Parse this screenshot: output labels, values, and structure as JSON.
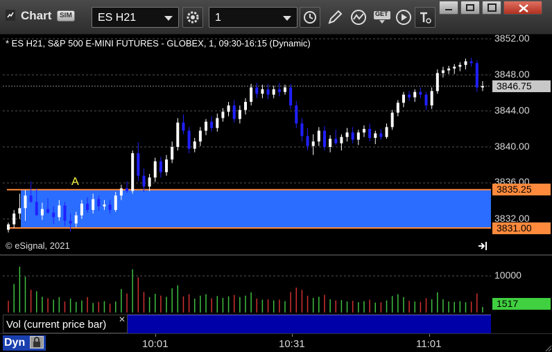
{
  "titlebar": {
    "title": "Chart",
    "badge": "SIM",
    "symbol": "ES H21",
    "interval": "1",
    "buttons": [
      "gear-icon",
      "clock-icon",
      "pencil-icon",
      "studies-icon",
      "get-icon",
      "play-icon",
      "text-icon"
    ],
    "get_label": "GET",
    "window_buttons": [
      "minimize",
      "restore",
      "maximize",
      "close"
    ]
  },
  "chart": {
    "header": "* ES H21, S&P 500 E-MINI FUTURES - GLOBEX, 1, 09:30-16:15 (Dynamic)",
    "copyright": "© eSignal, 2021",
    "marker_label": "A",
    "colors": {
      "up": "#ffffff",
      "down": "#2020ff",
      "zone": "#2a6dff",
      "zone_line": "#ff8a3d",
      "price_tag": "#c8c8c8"
    }
  },
  "price_axis": {
    "labels": [
      "3852.00",
      "3848.00",
      "3844.00",
      "3840.00",
      "3836.00",
      "3832.00"
    ],
    "last_price": "3846.75",
    "zone_high": "3835.25",
    "zone_low": "3831.00"
  },
  "volume": {
    "legend": "Vol (current price bar)",
    "axis_label": "10000",
    "last_volume": "1517",
    "colors": {
      "up": "#3fbf3f",
      "down": "#d03030",
      "tag": "#40d040"
    }
  },
  "time_axis": {
    "labels": [
      "10:01",
      "10:31",
      "11:01"
    ],
    "mode": "Dyn"
  },
  "chart_data": {
    "type": "candlestick",
    "ylim": [
      3830.0,
      3852.5
    ],
    "zone": [
      3831.0,
      3835.25
    ],
    "candles": [
      [
        3830.8,
        3831.6,
        3830.5,
        3831.4
      ],
      [
        3831.4,
        3833.0,
        3831.0,
        3832.6
      ],
      [
        3832.6,
        3834.8,
        3832.0,
        3833.2
      ],
      [
        3833.2,
        3835.2,
        3831.8,
        3834.6
      ],
      [
        3834.6,
        3836.2,
        3833.8,
        3833.9
      ],
      [
        3833.9,
        3835.4,
        3832.9,
        3832.4
      ],
      [
        3832.4,
        3833.8,
        3831.9,
        3833.1
      ],
      [
        3833.1,
        3834.3,
        3832.6,
        3832.7
      ],
      [
        3832.7,
        3833.4,
        3831.4,
        3832.2
      ],
      [
        3832.2,
        3834.1,
        3831.8,
        3833.5
      ],
      [
        3833.5,
        3833.9,
        3831.2,
        3831.8
      ],
      [
        3831.8,
        3832.6,
        3830.6,
        3831.5
      ],
      [
        3831.5,
        3832.8,
        3831.1,
        3832.4
      ],
      [
        3832.4,
        3834.1,
        3832.0,
        3833.7
      ],
      [
        3833.7,
        3834.4,
        3832.7,
        3833.0
      ],
      [
        3833.0,
        3834.8,
        3832.6,
        3834.2
      ],
      [
        3834.2,
        3834.6,
        3832.9,
        3833.4
      ],
      [
        3833.4,
        3834.1,
        3833.0,
        3833.6
      ],
      [
        3833.6,
        3834.1,
        3832.6,
        3833.0
      ],
      [
        3833.0,
        3835.0,
        3832.8,
        3834.6
      ],
      [
        3834.6,
        3835.8,
        3834.1,
        3835.4
      ],
      [
        3835.4,
        3836.2,
        3834.9,
        3835.1
      ],
      [
        3835.1,
        3839.6,
        3834.8,
        3839.3
      ],
      [
        3839.3,
        3840.5,
        3836.2,
        3836.8
      ],
      [
        3836.8,
        3837.6,
        3835.0,
        3835.6
      ],
      [
        3835.6,
        3837.0,
        3835.1,
        3836.6
      ],
      [
        3836.6,
        3838.8,
        3836.1,
        3838.4
      ],
      [
        3838.4,
        3838.9,
        3836.6,
        3837.2
      ],
      [
        3837.2,
        3839.1,
        3836.8,
        3838.6
      ],
      [
        3838.6,
        3840.6,
        3838.2,
        3840.0
      ],
      [
        3840.0,
        3843.2,
        3839.6,
        3842.7
      ],
      [
        3842.7,
        3843.6,
        3841.4,
        3841.8
      ],
      [
        3841.8,
        3842.2,
        3839.3,
        3839.8
      ],
      [
        3839.8,
        3841.0,
        3839.4,
        3840.6
      ],
      [
        3840.6,
        3842.2,
        3840.1,
        3841.8
      ],
      [
        3841.8,
        3843.1,
        3841.3,
        3842.8
      ],
      [
        3842.8,
        3843.4,
        3841.7,
        3842.1
      ],
      [
        3842.1,
        3843.7,
        3841.7,
        3843.2
      ],
      [
        3843.2,
        3844.3,
        3842.8,
        3843.9
      ],
      [
        3843.9,
        3845.0,
        3843.4,
        3844.6
      ],
      [
        3844.6,
        3845.2,
        3842.7,
        3843.1
      ],
      [
        3843.1,
        3844.6,
        3842.6,
        3844.1
      ],
      [
        3844.1,
        3845.4,
        3843.6,
        3845.0
      ],
      [
        3845.0,
        3847.0,
        3844.6,
        3846.6
      ],
      [
        3846.6,
        3847.1,
        3845.4,
        3845.9
      ],
      [
        3845.9,
        3846.9,
        3845.4,
        3846.4
      ],
      [
        3846.4,
        3847.0,
        3845.3,
        3845.8
      ],
      [
        3845.8,
        3846.8,
        3845.4,
        3846.4
      ],
      [
        3846.4,
        3847.1,
        3845.6,
        3846.1
      ],
      [
        3846.1,
        3846.9,
        3845.8,
        3846.6
      ],
      [
        3846.6,
        3847.0,
        3844.2,
        3844.6
      ],
      [
        3844.6,
        3845.1,
        3842.1,
        3842.6
      ],
      [
        3842.6,
        3843.2,
        3840.6,
        3841.2
      ],
      [
        3841.2,
        3842.1,
        3839.6,
        3840.1
      ],
      [
        3840.1,
        3841.4,
        3839.1,
        3840.6
      ],
      [
        3840.6,
        3842.2,
        3840.1,
        3841.8
      ],
      [
        3841.8,
        3842.3,
        3839.6,
        3840.0
      ],
      [
        3840.0,
        3841.3,
        3839.4,
        3840.9
      ],
      [
        3840.9,
        3841.9,
        3840.2,
        3840.4
      ],
      [
        3840.4,
        3841.4,
        3839.6,
        3841.1
      ],
      [
        3841.1,
        3842.1,
        3840.6,
        3841.6
      ],
      [
        3841.6,
        3842.2,
        3840.4,
        3840.8
      ],
      [
        3840.8,
        3841.9,
        3840.2,
        3841.6
      ],
      [
        3841.6,
        3842.4,
        3841.1,
        3842.0
      ],
      [
        3842.0,
        3842.6,
        3840.6,
        3841.0
      ],
      [
        3841.0,
        3841.8,
        3840.3,
        3841.5
      ],
      [
        3841.5,
        3842.0,
        3840.8,
        3841.1
      ],
      [
        3841.1,
        3842.6,
        3840.9,
        3842.2
      ],
      [
        3842.2,
        3844.1,
        3841.9,
        3843.8
      ],
      [
        3843.8,
        3845.2,
        3843.4,
        3844.9
      ],
      [
        3844.9,
        3846.1,
        3844.4,
        3845.8
      ],
      [
        3845.8,
        3846.2,
        3845.1,
        3845.5
      ],
      [
        3845.5,
        3846.4,
        3845.0,
        3846.1
      ],
      [
        3846.1,
        3846.6,
        3845.4,
        3845.8
      ],
      [
        3845.8,
        3846.1,
        3844.1,
        3844.6
      ],
      [
        3844.6,
        3846.6,
        3844.2,
        3846.2
      ],
      [
        3846.2,
        3848.6,
        3845.9,
        3848.2
      ],
      [
        3848.2,
        3848.9,
        3847.7,
        3848.5
      ],
      [
        3848.5,
        3849.0,
        3848.1,
        3848.7
      ],
      [
        3848.7,
        3849.2,
        3848.1,
        3848.9
      ],
      [
        3848.9,
        3849.4,
        3848.4,
        3849.1
      ],
      [
        3849.1,
        3849.8,
        3848.6,
        3849.5
      ],
      [
        3849.5,
        3849.9,
        3848.9,
        3849.3
      ],
      [
        3849.3,
        3849.6,
        3846.1,
        3846.6
      ],
      [
        3846.6,
        3847.3,
        3846.2,
        3846.75
      ]
    ],
    "volume": [
      [
        3200,
        "down"
      ],
      [
        7800,
        "up"
      ],
      [
        12500,
        "up"
      ],
      [
        9800,
        "up"
      ],
      [
        6200,
        "down"
      ],
      [
        5800,
        "up"
      ],
      [
        4300,
        "up"
      ],
      [
        3900,
        "down"
      ],
      [
        3500,
        "up"
      ],
      [
        4200,
        "up"
      ],
      [
        3000,
        "down"
      ],
      [
        3800,
        "up"
      ],
      [
        2900,
        "up"
      ],
      [
        3300,
        "up"
      ],
      [
        4200,
        "down"
      ],
      [
        2600,
        "up"
      ],
      [
        2900,
        "down"
      ],
      [
        3100,
        "up"
      ],
      [
        2400,
        "down"
      ],
      [
        3000,
        "up"
      ],
      [
        6400,
        "up"
      ],
      [
        5200,
        "down"
      ],
      [
        11800,
        "up"
      ],
      [
        9600,
        "down"
      ],
      [
        5600,
        "down"
      ],
      [
        4200,
        "up"
      ],
      [
        5100,
        "up"
      ],
      [
        4600,
        "down"
      ],
      [
        4300,
        "up"
      ],
      [
        6600,
        "up"
      ],
      [
        7400,
        "up"
      ],
      [
        4400,
        "down"
      ],
      [
        5000,
        "down"
      ],
      [
        3800,
        "up"
      ],
      [
        4600,
        "up"
      ],
      [
        5000,
        "up"
      ],
      [
        3900,
        "down"
      ],
      [
        4500,
        "up"
      ],
      [
        4000,
        "up"
      ],
      [
        4400,
        "up"
      ],
      [
        4800,
        "down"
      ],
      [
        4200,
        "up"
      ],
      [
        4600,
        "up"
      ],
      [
        5500,
        "up"
      ],
      [
        3800,
        "down"
      ],
      [
        3500,
        "up"
      ],
      [
        3600,
        "down"
      ],
      [
        3300,
        "up"
      ],
      [
        3500,
        "down"
      ],
      [
        3100,
        "up"
      ],
      [
        5600,
        "down"
      ],
      [
        6800,
        "down"
      ],
      [
        6200,
        "down"
      ],
      [
        4600,
        "down"
      ],
      [
        4000,
        "up"
      ],
      [
        4300,
        "up"
      ],
      [
        4800,
        "down"
      ],
      [
        3600,
        "up"
      ],
      [
        3300,
        "down"
      ],
      [
        3400,
        "up"
      ],
      [
        3000,
        "up"
      ],
      [
        3200,
        "down"
      ],
      [
        2800,
        "up"
      ],
      [
        3100,
        "up"
      ],
      [
        3500,
        "down"
      ],
      [
        2700,
        "up"
      ],
      [
        2800,
        "down"
      ],
      [
        3300,
        "up"
      ],
      [
        4500,
        "up"
      ],
      [
        5000,
        "up"
      ],
      [
        4200,
        "up"
      ],
      [
        3200,
        "down"
      ],
      [
        3000,
        "up"
      ],
      [
        2900,
        "down"
      ],
      [
        3900,
        "down"
      ],
      [
        3600,
        "up"
      ],
      [
        5500,
        "up"
      ],
      [
        3600,
        "up"
      ],
      [
        3000,
        "up"
      ],
      [
        2900,
        "up"
      ],
      [
        3100,
        "up"
      ],
      [
        2800,
        "up"
      ],
      [
        3000,
        "down"
      ],
      [
        5200,
        "down"
      ],
      [
        1517,
        "up"
      ]
    ],
    "vol_max": 14000
  }
}
